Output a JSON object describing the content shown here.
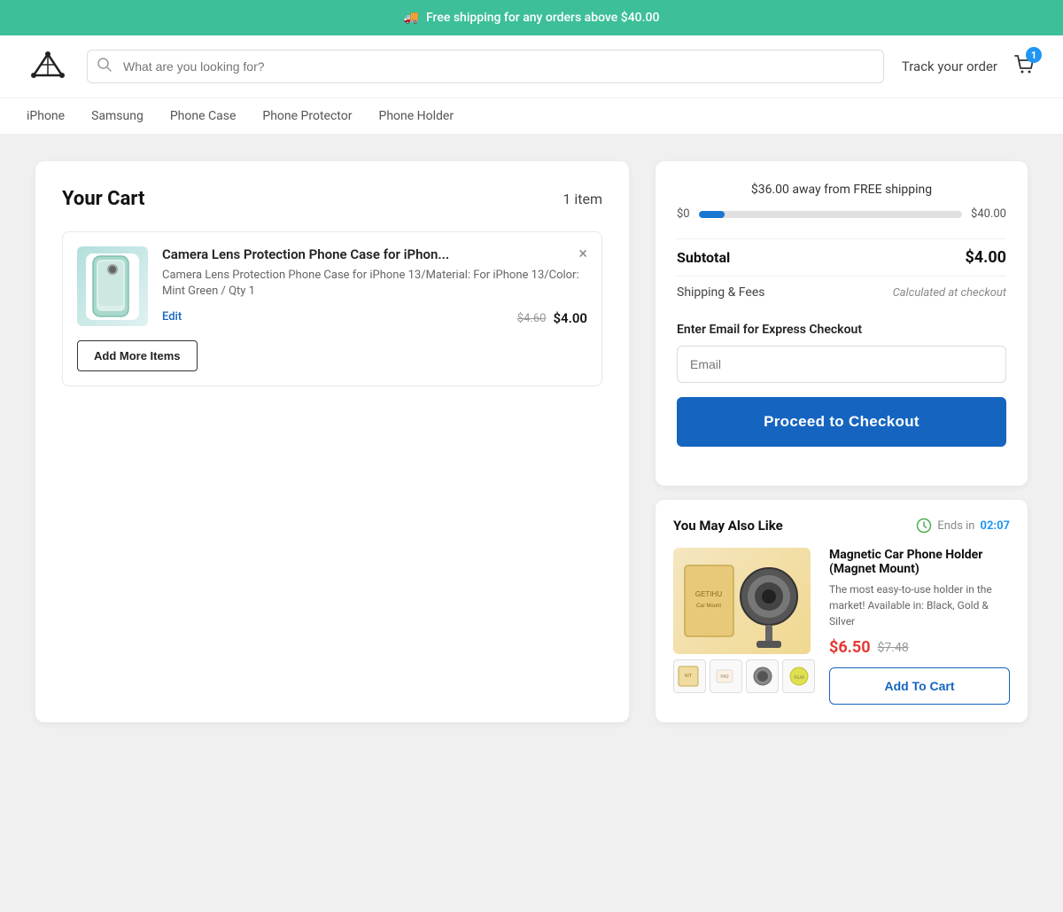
{
  "banner": {
    "text": "Free shipping for any orders above $40.00"
  },
  "header": {
    "search_placeholder": "What are you looking for?",
    "track_order": "Track your order",
    "cart_count": "1"
  },
  "nav": {
    "items": [
      {
        "label": "iPhone"
      },
      {
        "label": "Samsung"
      },
      {
        "label": "Phone Case"
      },
      {
        "label": "Phone Protector"
      },
      {
        "label": "Phone Holder"
      }
    ]
  },
  "cart": {
    "title": "Your Cart",
    "item_count": "1 item",
    "item": {
      "name": "Camera Lens Protection Phone Case for iPhon...",
      "full_name": "Camera Lens Protection Phone Case for iPhone 13/Material: For iPhone 13/Color: Mint Green / Qty 1",
      "edit_label": "Edit",
      "close_label": "×",
      "price_original": "$4.60",
      "price_current": "$4.00"
    },
    "add_more_label": "Add More Items"
  },
  "order_summary": {
    "shipping_notice": "$36.00 away from FREE shipping",
    "progress_start": "$0",
    "progress_end": "$40.00",
    "subtotal_label": "Subtotal",
    "subtotal_value": "$4.00",
    "shipping_label": "Shipping & Fees",
    "shipping_value": "Calculated at checkout",
    "email_section_label": "Enter Email for Express Checkout",
    "email_placeholder": "Email",
    "checkout_label": "Proceed to Checkout"
  },
  "recommendations": {
    "title": "You May Also Like",
    "timer_ends": "Ends in",
    "timer_value": "02:07",
    "product": {
      "name": "Magnetic Car Phone Holder (Magnet Mount)",
      "description": "The most easy-to-use holder in the market! Available in: Black, Gold & Silver",
      "price_current": "$6.50",
      "price_original": "$7.48",
      "add_to_cart_label": "Add To Cart"
    },
    "thumbnails": [
      "1\" Car Mount Removal Kit",
      "1\" Alcohol Prep Pad",
      "2\" Metal Plate",
      "2\" Protective Film"
    ]
  }
}
